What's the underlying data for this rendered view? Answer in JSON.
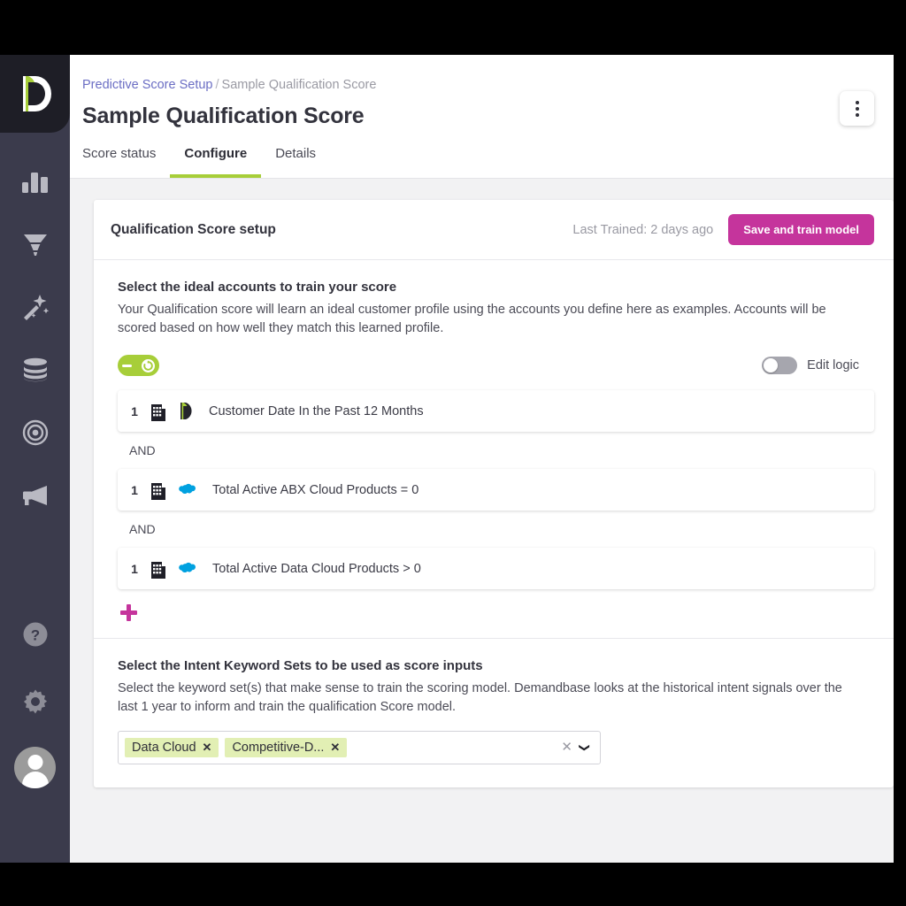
{
  "sidebar": {
    "logo": {
      "name": "demandbase-logo",
      "letter": "D"
    },
    "top_items": [
      {
        "icon": "bar-chart-icon",
        "name": "analytics"
      },
      {
        "icon": "funnel-icon",
        "name": "funnel"
      },
      {
        "icon": "magic-wand-icon",
        "name": "intent"
      },
      {
        "icon": "database-stack-icon",
        "name": "data"
      },
      {
        "icon": "target-icon",
        "name": "audiences"
      },
      {
        "icon": "megaphone-icon",
        "name": "advertising"
      }
    ],
    "bottom_items": [
      {
        "icon": "help-icon",
        "name": "help"
      },
      {
        "icon": "gear-icon",
        "name": "settings"
      },
      {
        "icon": "avatar-icon",
        "name": "user-profile"
      }
    ]
  },
  "breadcrumb": {
    "parent": "Predictive Score Setup",
    "separator": "/",
    "current": "Sample Qualification Score"
  },
  "page": {
    "title": "Sample Qualification Score",
    "kebab_label": "More actions"
  },
  "tabs": [
    {
      "label": "Score status",
      "active": false
    },
    {
      "label": "Configure",
      "active": true
    },
    {
      "label": "Details",
      "active": false
    }
  ],
  "card": {
    "header_title": "Qualification Score setup",
    "last_trained": "Last Trained: 2 days ago",
    "save_button": "Save and train model"
  },
  "accounts_section": {
    "title": "Select the ideal accounts to train your score",
    "description": "Your Qualification score will learn an ideal customer profile using the accounts you define here as examples. Accounts will be scored based on how well they match this learned profile.",
    "collapse_pill": "collapse-refresh-pill",
    "edit_logic_label": "Edit logic",
    "edit_logic_on": false,
    "rules": [
      {
        "number": "1",
        "entity_icon": "building-icon",
        "source_icon": "demandbase-icon",
        "text": "Customer Date In the Past 12 Months"
      },
      {
        "number": "1",
        "entity_icon": "building-icon",
        "source_icon": "salesforce-icon",
        "text": "Total Active ABX Cloud Products = 0"
      },
      {
        "number": "1",
        "entity_icon": "building-icon",
        "source_icon": "salesforce-icon",
        "text": "Total Active Data Cloud Products > 0"
      }
    ],
    "connector": "AND",
    "add_rule_label": "Add rule"
  },
  "intent_section": {
    "title": "Select the Intent Keyword Sets to be used as score inputs",
    "description": "Select the keyword set(s) that make sense to train the scoring model. Demandbase looks at the historical intent signals over the last 1 year to inform and train the qualification Score model.",
    "chips": [
      {
        "label": "Data Cloud",
        "remove": "✕"
      },
      {
        "label": "Competitive-D...",
        "remove": "✕"
      }
    ],
    "clear_all": "✕",
    "caret": "❯"
  },
  "colors": {
    "accent_pink": "#c5349c",
    "accent_green": "#a7ce39",
    "chip_green": "#e2efb4",
    "sidebar": "#3b3b4c",
    "link": "#6b6ec4"
  }
}
